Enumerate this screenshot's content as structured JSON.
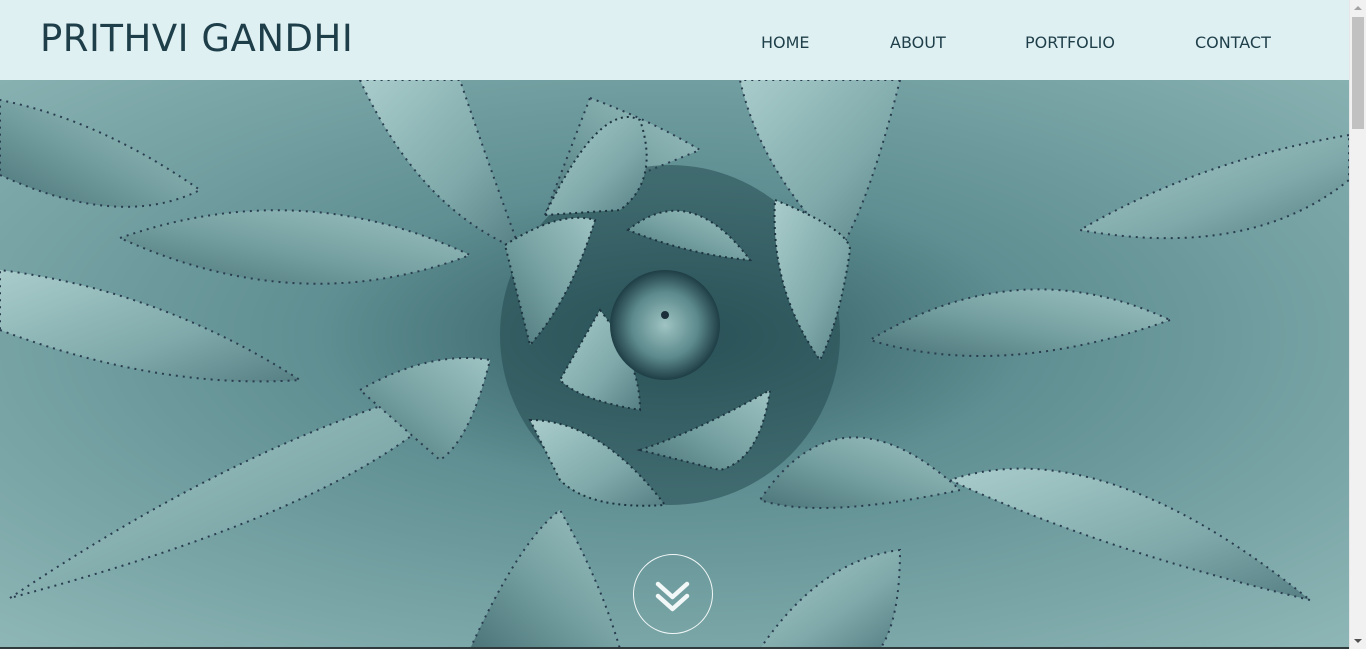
{
  "header": {
    "brand": "PRITHVI GANDHI",
    "nav": [
      {
        "label": "HOME"
      },
      {
        "label": "ABOUT"
      },
      {
        "label": "PORTFOLIO"
      },
      {
        "label": "CONTACT"
      }
    ]
  },
  "hero": {
    "image_subject": "agave succulent",
    "scroll_button_icon": "double-chevron-down-icon"
  },
  "colors": {
    "header_background": "#dff0f2",
    "text": "#1e3f4a",
    "hero_tone": "#5d8a8d"
  }
}
